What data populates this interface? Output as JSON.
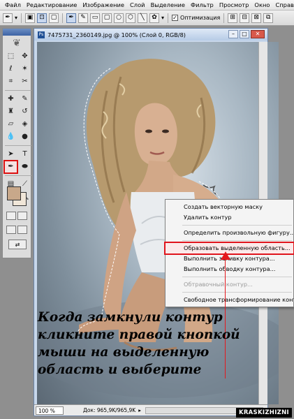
{
  "menubar": {
    "items": [
      "Файл",
      "Редактирование",
      "Изображение",
      "Слой",
      "Выделение",
      "Фильтр",
      "Просмотр",
      "Окно",
      "Справка"
    ]
  },
  "optbar": {
    "tool_icon": "pen-tool-icon",
    "optimize_label": "Оптимизация",
    "optimize_checked": true
  },
  "document": {
    "title": "7475731_2360149.jpg @ 100% (Слой 0, RGB/8)",
    "zoom": "100 %",
    "doc_info": "Док: 965,9K/965,9K"
  },
  "context_menu": {
    "items": [
      {
        "label": "Создать векторную маску",
        "disabled": false
      },
      {
        "label": "Удалить контур",
        "disabled": false
      },
      {
        "label": "Определить произвольную фигуру...",
        "disabled": false
      },
      {
        "label": "Образовать выделенную область...",
        "disabled": false,
        "highlighted": true
      },
      {
        "label": "Выполнить заливку контура...",
        "disabled": false
      },
      {
        "label": "Выполнить обводку контура...",
        "disabled": false
      },
      {
        "label": "Обтравочный контур...",
        "disabled": true
      },
      {
        "label": "Свободное трансформирование контура",
        "disabled": false
      }
    ]
  },
  "caption": {
    "text": "Когда замкнули контур\nкликните правой кнопкой\nмыши на выделенную\nобласть и выберите"
  },
  "watermark": {
    "text": "KRASKIZHIZNI"
  },
  "colors": {
    "highlight": "#e0141c",
    "foreground_swatch": "#c8a88a",
    "background_swatch": "#f0e6d8"
  }
}
